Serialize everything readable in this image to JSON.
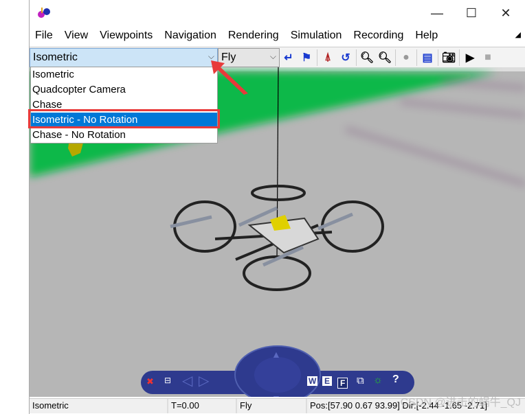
{
  "window": {
    "minimize": "—",
    "maximize": "☐",
    "close": "✕"
  },
  "menu": [
    "File",
    "View",
    "Viewpoints",
    "Navigation",
    "Rendering",
    "Simulation",
    "Recording",
    "Help"
  ],
  "toolbar": {
    "viewpoint_value": "Isometric",
    "navigation_value": "Fly",
    "icons": [
      "go-back-icon",
      "flag-icon",
      "straighten-icon",
      "undo-move-icon",
      "zoom-in-icon",
      "zoom-out-icon",
      "record-icon",
      "clipboard-icon",
      "camera-icon",
      "play-icon",
      "stop-icon"
    ]
  },
  "viewpoint_options": [
    "Isometric",
    "Quadcopter Camera",
    "Chase",
    "Isometric - No Rotation",
    "Chase - No Rotation"
  ],
  "selected_option": "Isometric - No Rotation",
  "nav_panel": {
    "walk": "W",
    "examine": "E",
    "fly": "F",
    "help": "?"
  },
  "status": {
    "viewpoint": "Isometric",
    "time": "T=0.00",
    "mode": "Fly",
    "pos": "Pos:[57.90 0.67 93.99] Dir:[-2.44 -1.65 -2.71]"
  },
  "watermark": "CSDN @进击的蜗牛_QJ",
  "colors": {
    "highlight": "#0078d7",
    "annotation": "#e83a3a",
    "ground": "#b6b6b6",
    "grass": "#0fb84a",
    "panel": "#2e3a8e"
  }
}
